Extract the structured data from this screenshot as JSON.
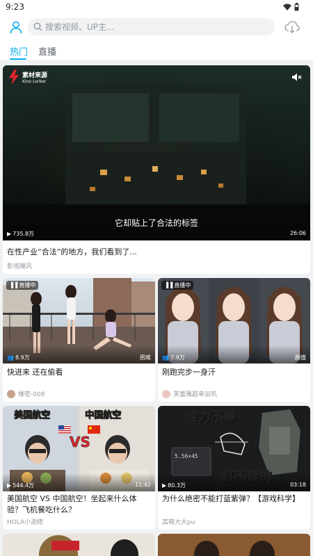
{
  "status": {
    "time": "9:23"
  },
  "search": {
    "placeholder": "搜索视频、UP主..."
  },
  "tabs": [
    {
      "label": "热门"
    },
    {
      "label": "直播"
    }
  ],
  "feature": {
    "logo_title": "素材来源",
    "logo_sub": "Kino Lorber",
    "subtitle": "它却贴上了合法的标签",
    "views": "735.8万",
    "duration": "26:06",
    "title": "在性产业“合法”的地方，我们看到了...",
    "author": "影视飓风"
  },
  "cards": [
    {
      "badge": "直播中",
      "viewers": "8.9万",
      "tag": "困难",
      "title": "快进来 还在偷看",
      "author": "维密-008"
    },
    {
      "badge": "直播中",
      "viewers": "7.9万",
      "tag": "颜值",
      "title": "刚跑完步一身汗",
      "author": "芙蕾雅超幸运叽"
    },
    {
      "thumb_left": "美国航空",
      "thumb_right": "中国航空",
      "vs": "VS",
      "views": "544.4万",
      "duration": "11:42",
      "title": "美国航空 VS 中国航空！坐起来什么体验？飞机餐吃什么？",
      "author": "HOLA小测佬"
    },
    {
      "thumb_top": "应力不够",
      "thumb_bottom": "打不穿的",
      "box_text": "5.56×45",
      "views": "80.3万",
      "duration": "03:18",
      "title": "为什么绝密不能打蓝紫弹？【游戏科学】",
      "author": "高萌大大pu"
    }
  ],
  "colors": {
    "accent": "#00aeec",
    "bg": "#f1f2f3"
  }
}
